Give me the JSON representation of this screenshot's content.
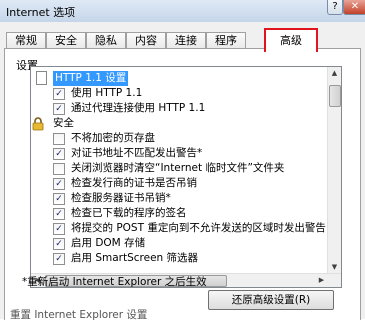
{
  "window": {
    "title": "Internet 选项",
    "help_label": "?",
    "close_label": "✕"
  },
  "tabs": [
    {
      "label": "常规"
    },
    {
      "label": "安全"
    },
    {
      "label": "隐私"
    },
    {
      "label": "内容"
    },
    {
      "label": "连接"
    },
    {
      "label": "程序"
    },
    {
      "label": "高级"
    }
  ],
  "active_tab": "高级",
  "settings": {
    "section_label": "设置",
    "items": [
      {
        "kind": "group",
        "icon": "document-icon",
        "label": "HTTP 1.1 设置",
        "selected": true
      },
      {
        "kind": "option",
        "checked": true,
        "label": "使用 HTTP 1.1"
      },
      {
        "kind": "option",
        "checked": true,
        "label": "通过代理连接使用 HTTP 1.1"
      },
      {
        "kind": "group",
        "icon": "lock-icon",
        "label": "安全"
      },
      {
        "kind": "option",
        "checked": false,
        "label": "不将加密的页存盘"
      },
      {
        "kind": "option",
        "checked": true,
        "label": "对证书地址不匹配发出警告*"
      },
      {
        "kind": "option",
        "checked": false,
        "label": "关闭浏览器时清空“Internet 临时文件”文件夹"
      },
      {
        "kind": "option",
        "checked": true,
        "label": "检查发行商的证书是否吊销"
      },
      {
        "kind": "option",
        "checked": true,
        "label": "检查服务器证书吊销*"
      },
      {
        "kind": "option",
        "checked": true,
        "label": "检查已下载的程序的签名"
      },
      {
        "kind": "option",
        "checked": true,
        "label": "将提交的 POST 重定向到不允许发送的区域时发出警告"
      },
      {
        "kind": "option",
        "checked": true,
        "label": "启用 DOM 存储"
      },
      {
        "kind": "option",
        "checked": true,
        "label": "启用 SmartScreen 筛选器"
      }
    ]
  },
  "footer": {
    "restart_note": "*重新启动 Internet Explorer 之后生效",
    "restore_button": "还原高级设置(R)",
    "bottom_partial": "重置 Internet Explorer 设置"
  }
}
